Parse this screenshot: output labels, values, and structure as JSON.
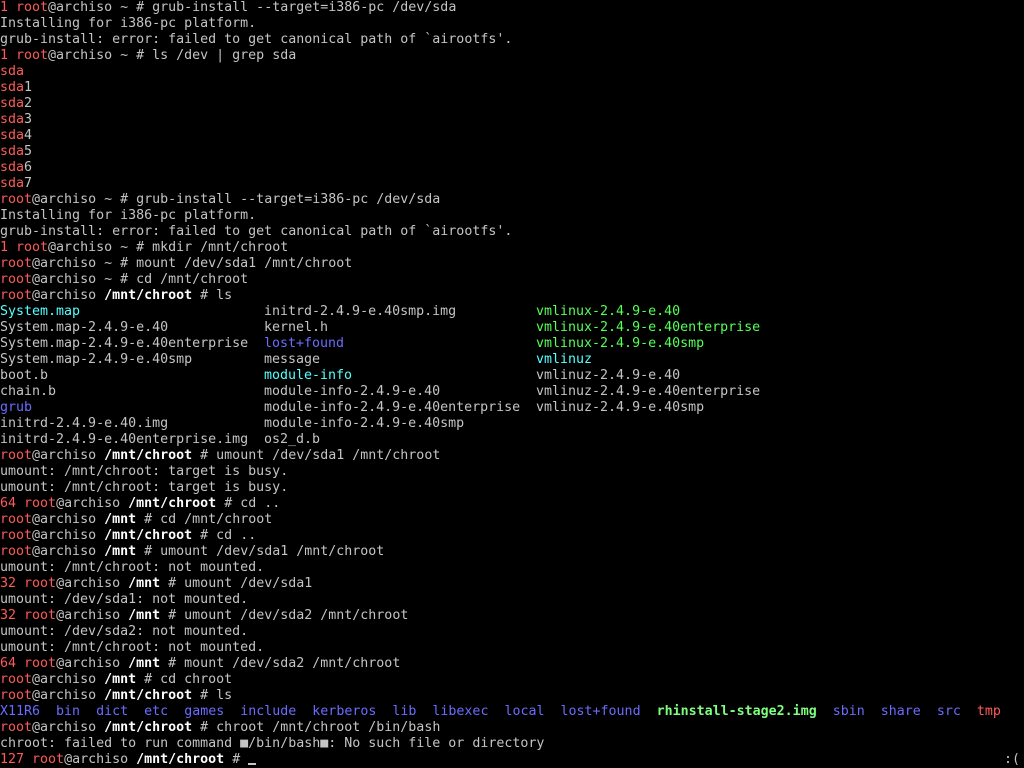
{
  "terminal": {
    "status_indicator": ":(",
    "before": [
      [
        [
          "1 ",
          "red"
        ],
        [
          "root",
          "red"
        ],
        [
          "@archiso ~ # grub-install --target=i386-pc /dev/sda",
          "gray"
        ]
      ],
      [
        [
          "Installing for i386-pc platform.",
          "gray"
        ]
      ],
      [
        [
          "grub-install: error: failed to get canonical path of `airootfs'.",
          "gray"
        ]
      ],
      [
        [
          "1 ",
          "red"
        ],
        [
          "root",
          "red"
        ],
        [
          "@archiso ~ # ls /dev | grep sda",
          "gray"
        ]
      ],
      [
        [
          "sda",
          "red"
        ]
      ],
      [
        [
          "sda",
          "red"
        ],
        [
          "1",
          "gray"
        ]
      ],
      [
        [
          "sda",
          "red"
        ],
        [
          "2",
          "gray"
        ]
      ],
      [
        [
          "sda",
          "red"
        ],
        [
          "3",
          "gray"
        ]
      ],
      [
        [
          "sda",
          "red"
        ],
        [
          "4",
          "gray"
        ]
      ],
      [
        [
          "sda",
          "red"
        ],
        [
          "5",
          "gray"
        ]
      ],
      [
        [
          "sda",
          "red"
        ],
        [
          "6",
          "gray"
        ]
      ],
      [
        [
          "sda",
          "red"
        ],
        [
          "7",
          "gray"
        ]
      ],
      [
        [
          "root",
          "red"
        ],
        [
          "@archiso ~ # grub-install --target=i386-pc /dev/sda",
          "gray"
        ]
      ],
      [
        [
          "Installing for i386-pc platform.",
          "gray"
        ]
      ],
      [
        [
          "grub-install: error: failed to get canonical path of `airootfs'.",
          "gray"
        ]
      ],
      [
        [
          "1 ",
          "red"
        ],
        [
          "root",
          "red"
        ],
        [
          "@archiso ~ # mkdir /mnt/chroot",
          "gray"
        ]
      ],
      [
        [
          "root",
          "red"
        ],
        [
          "@archiso ~ # mount /dev/sda1 /mnt/chroot",
          "gray"
        ]
      ],
      [
        [
          "root",
          "red"
        ],
        [
          "@archiso ~ # cd /mnt/chroot",
          "gray"
        ]
      ],
      [
        [
          "root",
          "red"
        ],
        [
          "@archiso ",
          "gray"
        ],
        [
          "/mnt/chroot",
          "bold"
        ],
        [
          " # ls",
          "gray"
        ]
      ]
    ],
    "listing": [
      [
        [
          "System.map",
          "cyan"
        ],
        [
          "initrd-2.4.9-e.40smp.img",
          "gray"
        ],
        [
          "vmlinux-2.4.9-e.40",
          "green"
        ]
      ],
      [
        [
          "System.map-2.4.9-e.40",
          "gray"
        ],
        [
          "kernel.h",
          "gray"
        ],
        [
          "vmlinux-2.4.9-e.40enterprise",
          "green"
        ]
      ],
      [
        [
          "System.map-2.4.9-e.40enterprise",
          "gray"
        ],
        [
          "lost+found",
          "blue"
        ],
        [
          "vmlinux-2.4.9-e.40smp",
          "green"
        ]
      ],
      [
        [
          "System.map-2.4.9-e.40smp",
          "gray"
        ],
        [
          "message",
          "gray"
        ],
        [
          "vmlinuz",
          "cyan"
        ]
      ],
      [
        [
          "boot.b",
          "gray"
        ],
        [
          "module-info",
          "cyan"
        ],
        [
          "vmlinuz-2.4.9-e.40",
          "gray"
        ]
      ],
      [
        [
          "chain.b",
          "gray"
        ],
        [
          "module-info-2.4.9-e.40",
          "gray"
        ],
        [
          "vmlinuz-2.4.9-e.40enterprise",
          "gray"
        ]
      ],
      [
        [
          "grub",
          "blue"
        ],
        [
          "module-info-2.4.9-e.40enterprise",
          "gray"
        ],
        [
          "vmlinuz-2.4.9-e.40smp",
          "gray"
        ]
      ],
      [
        [
          "initrd-2.4.9-e.40.img",
          "gray"
        ],
        [
          "module-info-2.4.9-e.40smp",
          "gray"
        ],
        [
          "",
          "gray"
        ]
      ],
      [
        [
          "initrd-2.4.9-e.40enterprise.img",
          "gray"
        ],
        [
          "os2_d.b",
          "gray"
        ],
        [
          "",
          "gray"
        ]
      ]
    ],
    "after": [
      [
        [
          "root",
          "red"
        ],
        [
          "@archiso ",
          "gray"
        ],
        [
          "/mnt/chroot",
          "bold"
        ],
        [
          " # umount /dev/sda1 /mnt/chroot",
          "gray"
        ]
      ],
      [
        [
          "umount: /mnt/chroot: target is busy.",
          "gray"
        ]
      ],
      [
        [
          "umount: /mnt/chroot: target is busy.",
          "gray"
        ]
      ],
      [
        [
          "64 ",
          "red"
        ],
        [
          "root",
          "red"
        ],
        [
          "@archiso ",
          "gray"
        ],
        [
          "/mnt/chroot",
          "bold"
        ],
        [
          " # cd ..",
          "gray"
        ]
      ],
      [
        [
          "root",
          "red"
        ],
        [
          "@archiso ",
          "gray"
        ],
        [
          "/mnt",
          "bold"
        ],
        [
          " # cd /mnt/chroot",
          "gray"
        ]
      ],
      [
        [
          "root",
          "red"
        ],
        [
          "@archiso ",
          "gray"
        ],
        [
          "/mnt/chroot",
          "bold"
        ],
        [
          " # cd ..",
          "gray"
        ]
      ],
      [
        [
          "root",
          "red"
        ],
        [
          "@archiso ",
          "gray"
        ],
        [
          "/mnt",
          "bold"
        ],
        [
          " # umount /dev/sda1 /mnt/chroot",
          "gray"
        ]
      ],
      [
        [
          "umount: /mnt/chroot: not mounted.",
          "gray"
        ]
      ],
      [
        [
          "32 ",
          "red"
        ],
        [
          "root",
          "red"
        ],
        [
          "@archiso ",
          "gray"
        ],
        [
          "/mnt",
          "bold"
        ],
        [
          " # umount /dev/sda1",
          "gray"
        ]
      ],
      [
        [
          "umount: /dev/sda1: not mounted.",
          "gray"
        ]
      ],
      [
        [
          "32 ",
          "red"
        ],
        [
          "root",
          "red"
        ],
        [
          "@archiso ",
          "gray"
        ],
        [
          "/mnt",
          "bold"
        ],
        [
          " # umount /dev/sda2 /mnt/chroot",
          "gray"
        ]
      ],
      [
        [
          "umount: /dev/sda2: not mounted.",
          "gray"
        ]
      ],
      [
        [
          "umount: /mnt/chroot: not mounted.",
          "gray"
        ]
      ],
      [
        [
          "64 ",
          "red"
        ],
        [
          "root",
          "red"
        ],
        [
          "@archiso ",
          "gray"
        ],
        [
          "/mnt",
          "bold"
        ],
        [
          " # mount /dev/sda2 /mnt/chroot",
          "gray"
        ]
      ],
      [
        [
          "root",
          "red"
        ],
        [
          "@archiso ",
          "gray"
        ],
        [
          "/mnt",
          "bold"
        ],
        [
          " # cd chroot",
          "gray"
        ]
      ],
      [
        [
          "root",
          "red"
        ],
        [
          "@archiso ",
          "gray"
        ],
        [
          "/mnt/chroot",
          "bold"
        ],
        [
          " # ls",
          "gray"
        ]
      ],
      [
        [
          "X11R6",
          "blue"
        ],
        [
          "  ",
          "gray"
        ],
        [
          "bin",
          "blue"
        ],
        [
          "  ",
          "gray"
        ],
        [
          "dict",
          "blue"
        ],
        [
          "  ",
          "gray"
        ],
        [
          "etc",
          "blue"
        ],
        [
          "  ",
          "gray"
        ],
        [
          "games",
          "blue"
        ],
        [
          "  ",
          "gray"
        ],
        [
          "include",
          "blue"
        ],
        [
          "  ",
          "gray"
        ],
        [
          "kerberos",
          "blue"
        ],
        [
          "  ",
          "gray"
        ],
        [
          "lib",
          "blue"
        ],
        [
          "  ",
          "gray"
        ],
        [
          "libexec",
          "blue"
        ],
        [
          "  ",
          "gray"
        ],
        [
          "local",
          "blue"
        ],
        [
          "  ",
          "gray"
        ],
        [
          "lost+found",
          "blue"
        ],
        [
          "  ",
          "gray"
        ],
        [
          "rhinstall-stage2.img",
          "bgreen"
        ],
        [
          "  ",
          "gray"
        ],
        [
          "sbin",
          "blue"
        ],
        [
          "  ",
          "gray"
        ],
        [
          "share",
          "blue"
        ],
        [
          "  ",
          "gray"
        ],
        [
          "src",
          "blue"
        ],
        [
          "  ",
          "gray"
        ],
        [
          "tmp",
          "red"
        ]
      ],
      [
        [
          "root",
          "red"
        ],
        [
          "@archiso ",
          "gray"
        ],
        [
          "/mnt/chroot",
          "bold"
        ],
        [
          " # chroot /mnt/chroot /bin/bash",
          "gray"
        ]
      ],
      [
        [
          "chroot: failed to run command ■/bin/bash■: No such file or directory",
          "gray"
        ]
      ],
      [
        [
          "127 ",
          "red"
        ],
        [
          "root",
          "red"
        ],
        [
          "@archiso ",
          "gray"
        ],
        [
          "/mnt/chroot",
          "bold"
        ],
        [
          " # ",
          "gray"
        ]
      ]
    ]
  }
}
